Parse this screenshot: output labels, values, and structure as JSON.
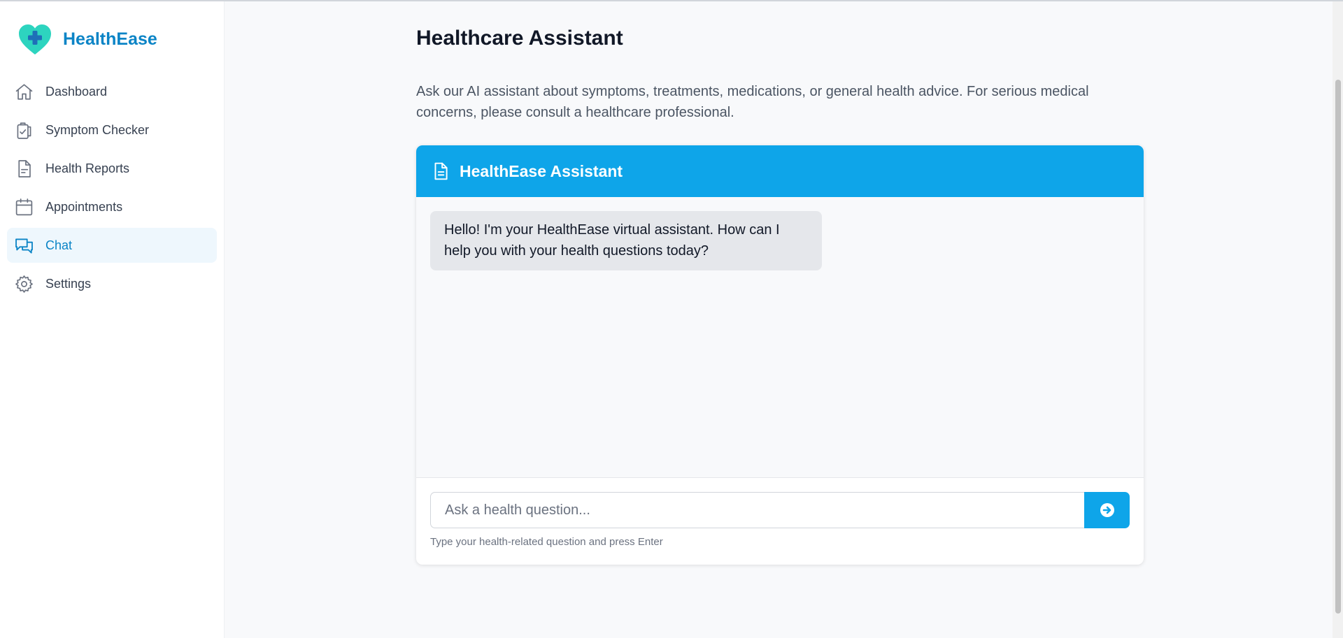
{
  "app": {
    "name": "HealthEase"
  },
  "sidebar": {
    "items": [
      {
        "label": "Dashboard",
        "icon": "home-icon",
        "active": false
      },
      {
        "label": "Symptom Checker",
        "icon": "clipboard-check-icon",
        "active": false
      },
      {
        "label": "Health Reports",
        "icon": "document-icon",
        "active": false
      },
      {
        "label": "Appointments",
        "icon": "calendar-icon",
        "active": false
      },
      {
        "label": "Chat",
        "icon": "chat-bubbles-icon",
        "active": true
      },
      {
        "label": "Settings",
        "icon": "gear-icon",
        "active": false
      }
    ]
  },
  "main": {
    "title": "Healthcare Assistant",
    "intro": "Ask our AI assistant about symptoms, treatments, medications, or general health advice. For serious medical concerns, please consult a healthcare professional."
  },
  "chat": {
    "header_title": "HealthEase Assistant",
    "header_icon": "document-icon",
    "messages": [
      {
        "sender": "assistant",
        "text": "Hello! I'm your HealthEase virtual assistant. How can I help you with your health questions today?"
      }
    ],
    "input": {
      "value": "",
      "placeholder": "Ask a health question..."
    },
    "send_icon": "arrow-right-circle-icon",
    "hint": "Type your health-related question and press Enter"
  },
  "colors": {
    "brand": "#0b84c6",
    "accent": "#0ea5e9",
    "logo_heart": "#2dd4bf",
    "active_nav_bg": "#eef7fd",
    "assistant_bubble": "#e5e7eb",
    "page_bg": "#f8f9fb"
  }
}
